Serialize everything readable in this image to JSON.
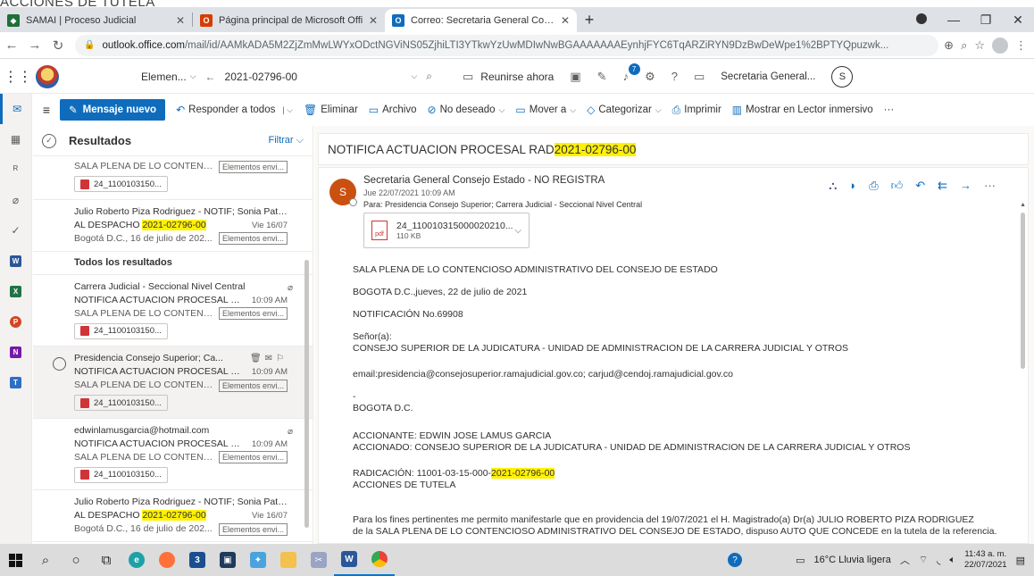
{
  "caption": "ACCIONES DE TUTELA",
  "browser": {
    "tabs": [
      {
        "label": "SAMAI | Proceso Judicial",
        "fav_color": "#1f6f3a"
      },
      {
        "label": "Página principal de Microsoft Offi",
        "fav_color": "#d83b01"
      },
      {
        "label": "Correo: Secretaria General Conse",
        "fav_color": "#0f6cbd"
      }
    ],
    "url_host": "outlook.office.com",
    "url_path": "/mail/id/AAMkADA5M2ZjZmMwLWYxODctNGViNS05ZjhiLTI3YTkwYzUwMDIwNwBGAAAAAAAEynhjFYC6TqARZiRYN9DzBwDeWpe1%2BPTYQpuzwk..."
  },
  "header": {
    "search_scope": "Elemen...",
    "search_query": "2021-02796-00",
    "meet_now": "Reunirse ahora",
    "badge_count": "7",
    "account_name": "Secretaria General...",
    "account_initial": "S"
  },
  "command_bar": {
    "new_message": "Mensaje nuevo",
    "reply_all": "Responder a todos",
    "delete": "Eliminar",
    "archive": "Archivo",
    "junk": "No deseado",
    "move_to": "Mover a",
    "categorize": "Categorizar",
    "print": "Imprimir",
    "immersive_reader": "Mostrar en Lector inmersivo",
    "more": "···"
  },
  "list": {
    "title": "Resultados",
    "filter": "Filtrar",
    "section_all": "Todos los resultados",
    "top_items": [
      {
        "subject": "SALA PLENA DE LO CONTENCI...",
        "chip": "Elementos envi...",
        "attachment": "24_1100103150..."
      },
      {
        "from": "Julio Roberto Piza Rodriguez - NOTIF; Sonia Patri...",
        "subj_prefix": "AL DESPACHO ",
        "subj_hl": "2021-02796-00",
        "time": "Vie 16/07",
        "preview": "Bogotá D.C., 16 de julio de 202...",
        "chip": "Elementos envi..."
      }
    ],
    "results": [
      {
        "from": "Carrera Judicial - Seccional Nivel Central",
        "subj_prefix": "NOTIFICA ACTUACION PROCESAL RAD",
        "subj_hl": "..",
        "time": "10:09 AM",
        "preview": "SALA PLENA DE LO CONTENCI...",
        "chip": "Elementos envi...",
        "attachment": "24_1100103150..."
      },
      {
        "from": "Presidencia Consejo Superior; Ca...",
        "subj_prefix": "NOTIFICA ACTUACION PROCESAL RAD",
        "subj_hl": "..",
        "time": "10:09 AM",
        "preview": "SALA PLENA DE LO CONTENCI...",
        "chip": "Elementos envi...",
        "attachment": "24_1100103150..."
      },
      {
        "from": "edwinlamusgarcia@hotmail.com",
        "subj_prefix": "NOTIFICA ACTUACION PROCESAL RAD",
        "subj_hl": "..",
        "time": "10:09 AM",
        "preview": "SALA PLENA DE LO CONTENCI...",
        "chip": "Elementos envi...",
        "attachment": "24_1100103150..."
      },
      {
        "from": "Julio Roberto Piza Rodriguez - NOTIF; Sonia Patri...",
        "subj_prefix": "AL DESPACHO ",
        "subj_hl": "2021-02796-00",
        "time": "Vie 16/07",
        "preview": "Bogotá D.C., 16 de julio de 202...",
        "chip": "Elementos envi..."
      }
    ]
  },
  "reading": {
    "subject_prefix": "NOTIFICA ACTUACION PROCESAL RAD ",
    "subject_hl": "2021-02796-00",
    "sender_initial": "S",
    "sender": "Secretaria General Consejo Estado - NO REGISTRA",
    "date": "Jue 22/07/2021 10:09 AM",
    "to": "Para:  Presidencia Consejo Superior; Carrera Judicial - Seccional Nivel Central",
    "attachment_name": "24_110010315000020210...",
    "attachment_size": "110 KB",
    "attachment_type": "pdf",
    "body": {
      "p1": "SALA PLENA DE LO CONTENCIOSO ADMINISTRATIVO DEL CONSEJO DE ESTADO",
      "p2": "BOGOTA D.C.,jueves, 22 de julio de 2021",
      "p3": "NOTIFICACIÓN No.69908",
      "p4a": "Señor(a):",
      "p4b": "CONSEJO SUPERIOR DE LA JUDICATURA - UNIDAD DE ADMINISTRACION DE LA CARRERA JUDICIAL Y OTROS",
      "p5": "email:presidencia@consejosuperior.ramajudicial.gov.co; carjud@cendoj.ramajudicial.gov.co",
      "p6a": "-",
      "p6b": "BOGOTA D.C.",
      "p7a": "ACCIONANTE: EDWIN JOSE LAMUS GARCIA",
      "p7b": "ACCIONADO: CONSEJO SUPERIOR DE LA JUDICATURA - UNIDAD DE ADMINISTRACION DE LA CARRERA JUDICIAL Y OTROS",
      "p8_prefix": "RADICACIÓN: 11001-03-15-000-",
      "p8_hl": "2021-02796-00",
      "p8b": "ACCIONES DE TUTELA",
      "p9a": "Para los fines pertinentes me permito manifestarle que en providencia del 19/07/2021  el H. Magistrado(a) Dr(a) JULIO ROBERTO PIZA RODRIGUEZ",
      "p9b": "de la SALA PLENA DE LO CONTENCIOSO ADMINISTRATIVO DEL CONSEJO DE ESTADO, dispuso AUTO QUE CONCEDE en la tutela de la referencia."
    }
  },
  "taskbar": {
    "weather": "16°C  Lluvia ligera",
    "time": "11:43 a. m.",
    "date": "22/07/2021"
  }
}
